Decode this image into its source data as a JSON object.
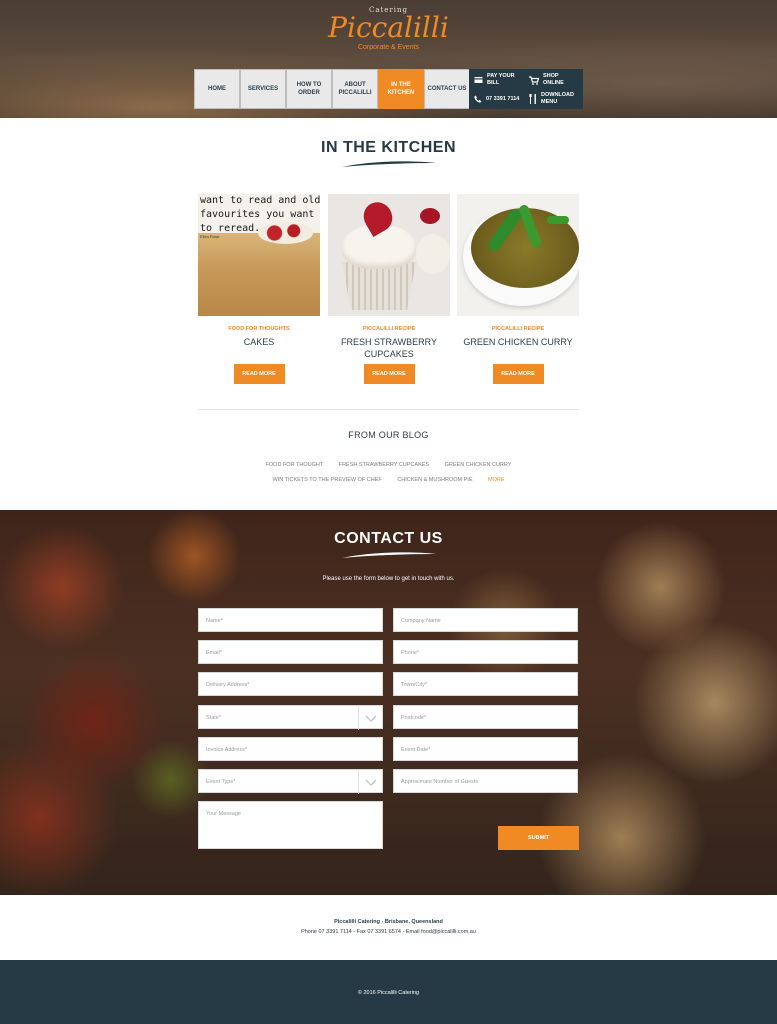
{
  "header": {
    "logo_top": "Catering",
    "logo_main": "Piccalilli",
    "logo_sub": "Corporate & Events",
    "nav": [
      {
        "label": "HOME"
      },
      {
        "label": "SERVICES"
      },
      {
        "label": "HOW TO ORDER"
      },
      {
        "label": "ABOUT PICCALILLI"
      },
      {
        "label": "IN THE KITCHEN"
      },
      {
        "label": "CONTACT US"
      }
    ],
    "active_nav": "IN THE KITCHEN",
    "utility": {
      "pay": "PAY YOUR BILL",
      "shop": "SHOP ONLINE",
      "phone": "07 3391 7114",
      "download": "DOWNLOAD MENU"
    }
  },
  "kitchen": {
    "title": "IN THE KITCHEN",
    "cards": [
      {
        "category": "FOOD FOR THOUGHTS",
        "title": "CAKES",
        "button": "READ MORE",
        "image_text": [
          "want to read and old",
          "favourites you want",
          "to reread."
        ],
        "image_credit": "Ellen Rose"
      },
      {
        "category": "PICCALILLI RECIPE",
        "title": "FRESH STRAWBERRY CUPCAKES",
        "button": "READ MORE"
      },
      {
        "category": "PICCALILLI RECIPE",
        "title": "GREEN CHICKEN CURRY",
        "button": "READ MORE"
      }
    ]
  },
  "blog": {
    "title": "FROM OUR BLOG",
    "row1": [
      "FOOD FOR THOUGHT",
      "FRESH STRAWBERRY CUPCAKES",
      "GREEN CHICKEN CURRY"
    ],
    "row2": [
      "WIN TICKETS TO THE PREVIEW OF CHEF",
      "CHICKEN & MUSHROOM PIE"
    ],
    "more": "MORE"
  },
  "contact": {
    "title": "CONTACT US",
    "subtitle": "Please use the form below to get in touch with us.",
    "fields": {
      "name": "Name*",
      "company": "Company Name",
      "email": "Email*",
      "phone": "Phone*",
      "delivery": "Delivery Address*",
      "town": "Town/City*",
      "state": "State*",
      "postcode": "Postcode*",
      "invoice": "Invoice Address*",
      "event_date": "Event Date*",
      "event_type": "Event Type*",
      "guests": "Approximate Number of Guests",
      "message": "Your Message"
    },
    "submit": "SUBMIT"
  },
  "footer": {
    "line1": "Piccalilli Catering - Brisbane, Queensland",
    "line2": "Phone 07 3391 7114 - Fax 07 3391 6574 - Email food@piccalilli.com.au",
    "copyright": "© 2016 Piccalilli Catering"
  },
  "colors": {
    "accent": "#f08a24",
    "dark": "#253a44"
  }
}
